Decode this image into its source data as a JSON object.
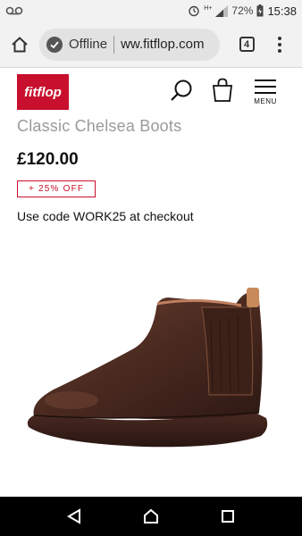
{
  "status_bar": {
    "voicemail_icon": "voicemail-icon",
    "alarm_icon": "alarm-icon",
    "signal_label": "H+",
    "battery_percent": "72%",
    "time": "15:38"
  },
  "browser": {
    "offline_label": "Offline",
    "url": "ww.fitflop.com",
    "tab_count": "4"
  },
  "site": {
    "logo_text": "fitflop",
    "menu_label": "MENU",
    "brand_color": "#c8102e"
  },
  "product": {
    "title": "Classic Chelsea Boots",
    "price": "£120.00",
    "discount_badge": "+ 25% OFF",
    "promo_text": "Use code WORK25 at checkout",
    "image_alt": "Brown leather chelsea boot"
  },
  "nav": {
    "back_icon": "back-triangle-icon",
    "home_icon": "home-circle-icon",
    "recents_icon": "recents-square-icon"
  }
}
